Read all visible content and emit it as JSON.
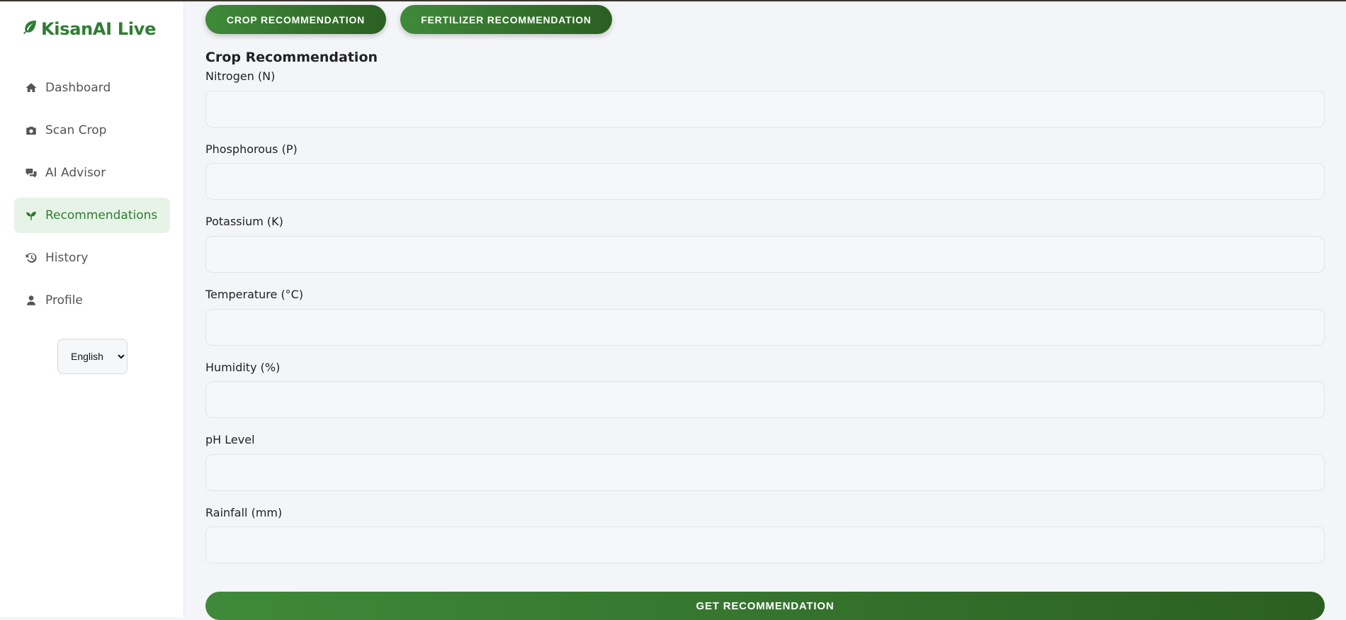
{
  "app": {
    "brand": "KisanAI Live",
    "brand_icon": "leaf-icon",
    "accent_color": "#2e7d32"
  },
  "sidebar": {
    "items": [
      {
        "label": "Dashboard",
        "icon": "home-icon",
        "active": false
      },
      {
        "label": "Scan Crop",
        "icon": "camera-icon",
        "active": false
      },
      {
        "label": "AI Advisor",
        "icon": "chat-icon",
        "active": false
      },
      {
        "label": "Recommendations",
        "icon": "seedling-icon",
        "active": true
      },
      {
        "label": "History",
        "icon": "history-icon",
        "active": false
      },
      {
        "label": "Profile",
        "icon": "user-icon",
        "active": false
      }
    ],
    "language": {
      "selected": "English",
      "options": [
        "English"
      ]
    }
  },
  "tabs": {
    "crop": "CROP RECOMMENDATION",
    "fertilizer": "FERTILIZER RECOMMENDATION"
  },
  "form": {
    "title": "Crop Recommendation",
    "fields": [
      {
        "label": "Nitrogen (N)",
        "value": ""
      },
      {
        "label": "Phosphorous (P)",
        "value": ""
      },
      {
        "label": "Potassium (K)",
        "value": ""
      },
      {
        "label": "Temperature (°C)",
        "value": ""
      },
      {
        "label": "Humidity (%)",
        "value": ""
      },
      {
        "label": "pH Level",
        "value": ""
      },
      {
        "label": "Rainfall (mm)",
        "value": ""
      }
    ],
    "submit_label": "GET RECOMMENDATION"
  }
}
